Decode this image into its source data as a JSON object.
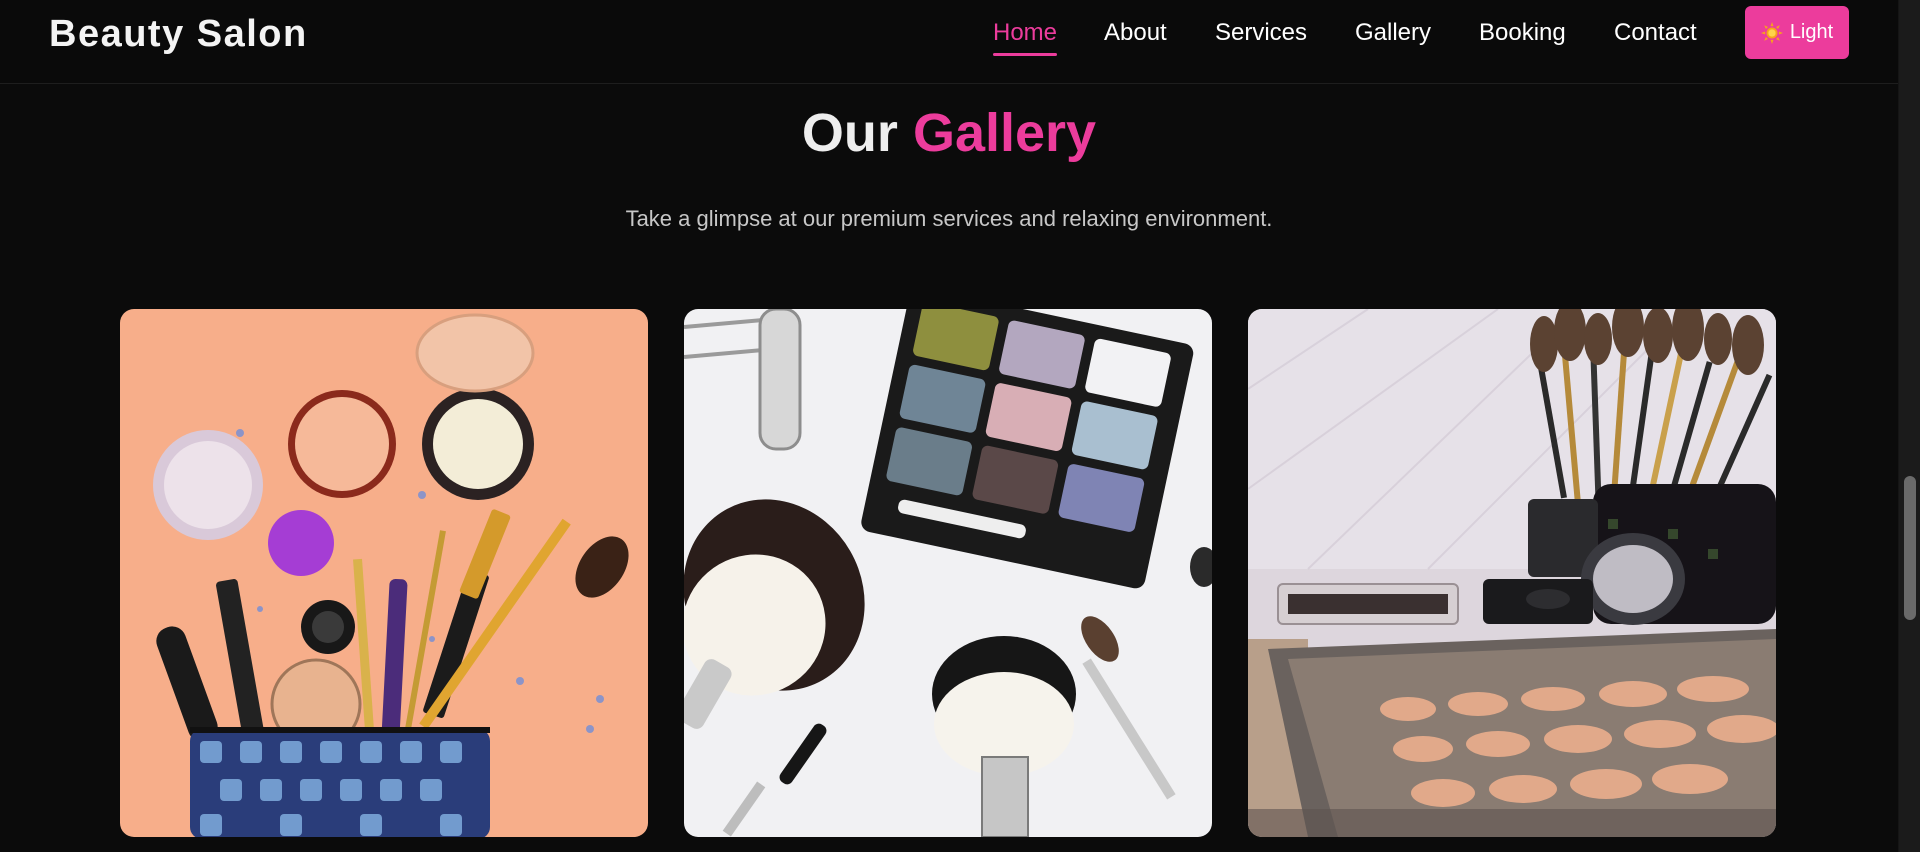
{
  "header": {
    "brand": "Beauty Salon",
    "nav": [
      {
        "label": "Home",
        "active": true
      },
      {
        "label": "About",
        "active": false
      },
      {
        "label": "Services",
        "active": false
      },
      {
        "label": "Gallery",
        "active": false
      },
      {
        "label": "Booking",
        "active": false
      },
      {
        "label": "Contact",
        "active": false
      }
    ],
    "theme_toggle": {
      "label": "Light",
      "icon": "sun-icon"
    }
  },
  "gallery": {
    "title_plain": "Our",
    "title_accent": "Gallery",
    "subtitle": "Take a glimpse at our premium services and relaxing environment.",
    "images": [
      {
        "name": "gallery-image-makeup-bag"
      },
      {
        "name": "gallery-image-eyeshadow-brushes"
      },
      {
        "name": "gallery-image-brush-holder"
      }
    ]
  },
  "colors": {
    "accent": "#ec3c9c",
    "background": "#0b0b0b",
    "text": "#ffffff"
  }
}
